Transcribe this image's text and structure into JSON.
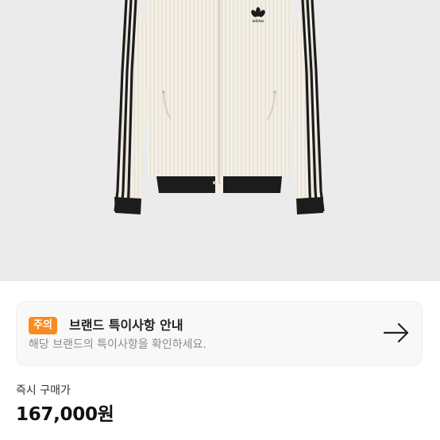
{
  "product": {
    "image_alt": "adidas",
    "logo_text": "adidas"
  },
  "notice": {
    "badge": "주의",
    "title": "브랜드 특이사항 안내",
    "description": "해당 브랜드의 특이사항을 확인하세요.",
    "arrow_icon": "arrow-right-icon"
  },
  "price": {
    "label": "즉시 구매가",
    "value": "167,000원"
  },
  "colors": {
    "badge": "#fa8a20",
    "image_background": "#ebebeb",
    "card_background": "#f8f8f8"
  }
}
